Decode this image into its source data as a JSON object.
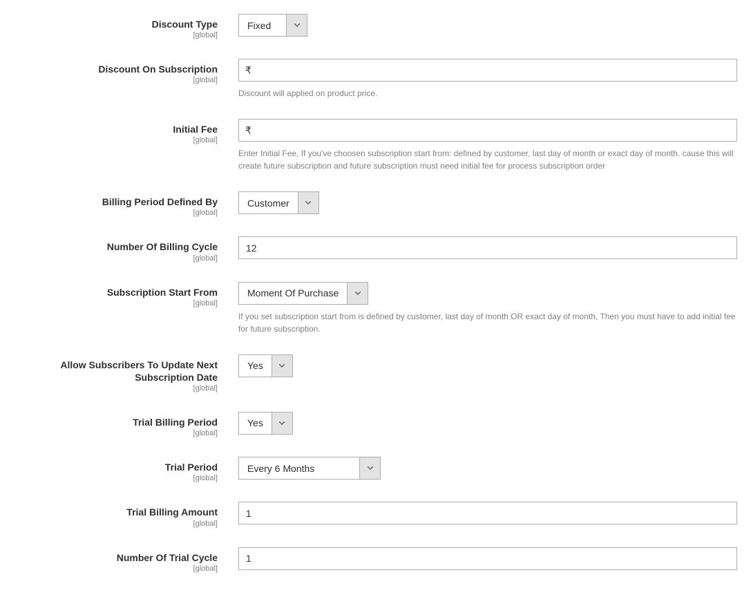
{
  "scope": "[global]",
  "fields": {
    "discount_type": {
      "label": "Discount Type",
      "value": "Fixed"
    },
    "discount_on_subscription": {
      "label": "Discount On Subscription",
      "currency": "₹",
      "value": "",
      "help": "Discount will applied on product price."
    },
    "initial_fee": {
      "label": "Initial Fee",
      "currency": "₹",
      "value": "",
      "help": "Enter Initial Fee, If you've choosen subscription start from: defined by customer, last day of month or exact day of month. cause this will create future subscription and future subscription must need initial fee for process subscription order"
    },
    "billing_period_defined_by": {
      "label": "Billing Period Defined By",
      "value": "Customer"
    },
    "number_of_billing_cycle": {
      "label": "Number Of Billing Cycle",
      "value": "12"
    },
    "subscription_start_from": {
      "label": "Subscription Start From",
      "value": "Moment Of Purchase",
      "help": "If you set subscription start from is defined by customer, last day of month OR exact day of month, Then you must have to add initial fee for future subscription."
    },
    "allow_update_next_date": {
      "label": "Allow Subscribers To Update Next Subscription Date",
      "value": "Yes"
    },
    "trial_billing_period": {
      "label": "Trial Billing Period",
      "value": "Yes"
    },
    "trial_period": {
      "label": "Trial Period",
      "value": "Every 6 Months"
    },
    "trial_billing_amount": {
      "label": "Trial Billing Amount",
      "value": "1"
    },
    "number_of_trial_cycle": {
      "label": "Number Of Trial Cycle",
      "value": "1"
    }
  }
}
